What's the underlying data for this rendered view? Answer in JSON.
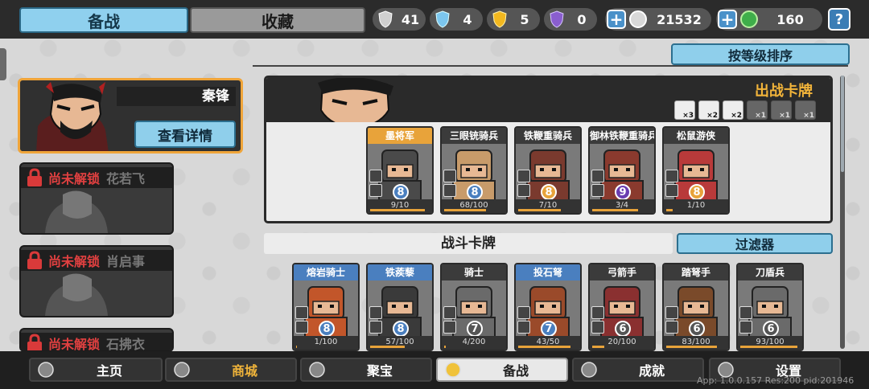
{
  "header": {
    "tab_active": "备战",
    "tab_inactive": "收藏",
    "resources": [
      {
        "icon": "silver-shield-icon",
        "value": "41",
        "color": "#c8c8c8"
      },
      {
        "icon": "blue-crystal-icon",
        "value": "4",
        "color": "#7cc7ef"
      },
      {
        "icon": "gold-shield-icon",
        "value": "5",
        "color": "#f2b81f"
      },
      {
        "icon": "purple-shield-icon",
        "value": "0",
        "color": "#8a5ecf"
      }
    ],
    "silver_coin": "21532",
    "green_gem": "160",
    "help": "?"
  },
  "sort_button": "按等级排序",
  "selected_hero": {
    "name": "秦锋",
    "detail_button": "查看详情"
  },
  "locked_heroes": [
    {
      "status": "尚未解锁",
      "name": "花若飞"
    },
    {
      "status": "尚未解锁",
      "name": "肖启事"
    },
    {
      "status": "尚未解锁",
      "name": "石拂衣"
    }
  ],
  "deck": {
    "title": "出战卡牌",
    "type_counts": [
      {
        "icon": "cavalry-type-icon",
        "count": "×3",
        "dim": false
      },
      {
        "icon": "archer-type-icon",
        "count": "×2",
        "dim": false
      },
      {
        "icon": "shield-type-icon",
        "count": "×2",
        "dim": false
      },
      {
        "icon": "sword-type-icon",
        "count": "×1",
        "dim": true
      },
      {
        "icon": "helmet-type-icon",
        "count": "×1",
        "dim": true
      },
      {
        "icon": "skull-type-icon",
        "count": "×1",
        "dim": true
      }
    ],
    "cards": [
      {
        "name": "墨将军",
        "level": "8",
        "progress": "9/10",
        "fill": 0.9,
        "header": "#e8a33a",
        "lvcolor": "#4a7fbf",
        "skin": "#4a4a4a"
      },
      {
        "name": "三眼铳骑兵",
        "level": "8",
        "progress": "68/100",
        "fill": 0.68,
        "header": "#3b3b3b",
        "lvcolor": "#4a7fbf",
        "skin": "#c89b6a"
      },
      {
        "name": "铁鞭重骑兵",
        "level": "8",
        "progress": "7/10",
        "fill": 0.7,
        "header": "#3b3b3b",
        "lvcolor": "#e8a33a",
        "skin": "#7a3a2e"
      },
      {
        "name": "御林铁鞭重骑兵",
        "level": "9",
        "progress": "3/4",
        "fill": 0.75,
        "header": "#3b3b3b",
        "lvcolor": "#6a3db0",
        "skin": "#8a3a2e"
      },
      {
        "name": "松鼠游侠",
        "level": "8",
        "progress": "1/10",
        "fill": 0.1,
        "header": "#3b3b3b",
        "lvcolor": "#e8a33a",
        "skin": "#b83a3a"
      }
    ]
  },
  "battle": {
    "title": "战斗卡牌",
    "filter_button": "过滤器",
    "cards": [
      {
        "name": "熔岩骑士",
        "level": "8",
        "progress": "1/100",
        "fill": 0.01,
        "header": "#4a7fbf",
        "lvcolor": "#4a7fbf",
        "skin": "#c2562a"
      },
      {
        "name": "铁蒺藜",
        "level": "8",
        "progress": "57/100",
        "fill": 0.57,
        "header": "#4a7fbf",
        "lvcolor": "#4a7fbf",
        "skin": "#3a3a3a"
      },
      {
        "name": "骑士",
        "level": "7",
        "progress": "4/200",
        "fill": 0.02,
        "header": "#3b3b3b",
        "lvcolor": "#555555",
        "skin": "#6a6a6a"
      },
      {
        "name": "投石弩",
        "level": "7",
        "progress": "43/50",
        "fill": 0.86,
        "header": "#4a7fbf",
        "lvcolor": "#4a7fbf",
        "skin": "#9a4a2a"
      },
      {
        "name": "弓箭手",
        "level": "6",
        "progress": "20/100",
        "fill": 0.2,
        "header": "#3b3b3b",
        "lvcolor": "#555555",
        "skin": "#8a3030"
      },
      {
        "name": "踏弩手",
        "level": "6",
        "progress": "83/100",
        "fill": 0.83,
        "header": "#3b3b3b",
        "lvcolor": "#555555",
        "skin": "#7a4a2a"
      },
      {
        "name": "刀盾兵",
        "level": "6",
        "progress": "93/100",
        "fill": 0.93,
        "header": "#3b3b3b",
        "lvcolor": "#555555",
        "skin": "#6a6a6a"
      }
    ]
  },
  "nav": [
    {
      "label": "主页",
      "icon": "home-icon",
      "active": false,
      "gold": false
    },
    {
      "label": "商城",
      "icon": "coins-icon",
      "active": false,
      "gold": true
    },
    {
      "label": "聚宝",
      "icon": "treasure-icon",
      "active": false,
      "gold": false
    },
    {
      "label": "备战",
      "icon": "card-icon",
      "active": true,
      "gold": false
    },
    {
      "label": "成就",
      "icon": "achievement-icon",
      "active": false,
      "gold": false
    },
    {
      "label": "设置",
      "icon": "gear-icon",
      "active": false,
      "gold": false
    }
  ],
  "version_text": "App: 1.0.0.157 Res:200 pid:201946"
}
